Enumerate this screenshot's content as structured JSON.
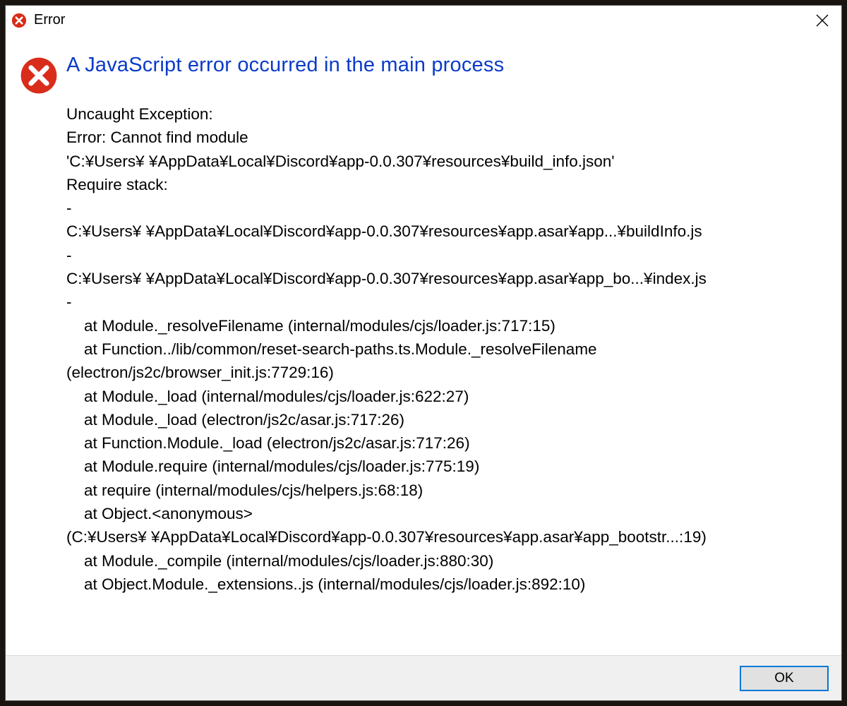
{
  "title": "Error",
  "heading": "A JavaScript error occurred in the main process",
  "redacted": "      ",
  "body": {
    "l1": "Uncaught Exception:",
    "l2": "Error: Cannot find module",
    "l3a": "'C:¥Users¥",
    "l3b": "¥AppData¥Local¥Discord¥app-0.0.307¥resources¥build_info.json'",
    "l4": "Require stack:",
    "dash": "-",
    "p1a": "C:¥Users¥",
    "p1b": "¥AppData¥Local¥Discord¥app-0.0.307¥resources¥app.asar¥app...¥buildInfo.js",
    "p2a": "C:¥Users¥",
    "p2b": "¥AppData¥Local¥Discord¥app-0.0.307¥resources¥app.asar¥app_bo...¥index.js",
    "s1": "    at Module._resolveFilename (internal/modules/cjs/loader.js:717:15)",
    "s2a": "    at Function../lib/common/reset-search-paths.ts.Module._resolveFilename",
    "s2b": "(electron/js2c/browser_init.js:7729:16)",
    "s3": "    at Module._load (internal/modules/cjs/loader.js:622:27)",
    "s4": "    at Module._load (electron/js2c/asar.js:717:26)",
    "s5": "    at Function.Module._load (electron/js2c/asar.js:717:26)",
    "s6": "    at Module.require (internal/modules/cjs/loader.js:775:19)",
    "s7": "    at require (internal/modules/cjs/helpers.js:68:18)",
    "s8": "    at Object.<anonymous>",
    "s9a": "(C:¥Users¥",
    "s9b": "¥AppData¥Local¥Discord¥app-0.0.307¥resources¥app.asar¥app_bootstr...:19)",
    "s10": "    at Module._compile (internal/modules/cjs/loader.js:880:30)",
    "s11": "    at Object.Module._extensions..js (internal/modules/cjs/loader.js:892:10)"
  },
  "buttons": {
    "ok": "OK"
  }
}
